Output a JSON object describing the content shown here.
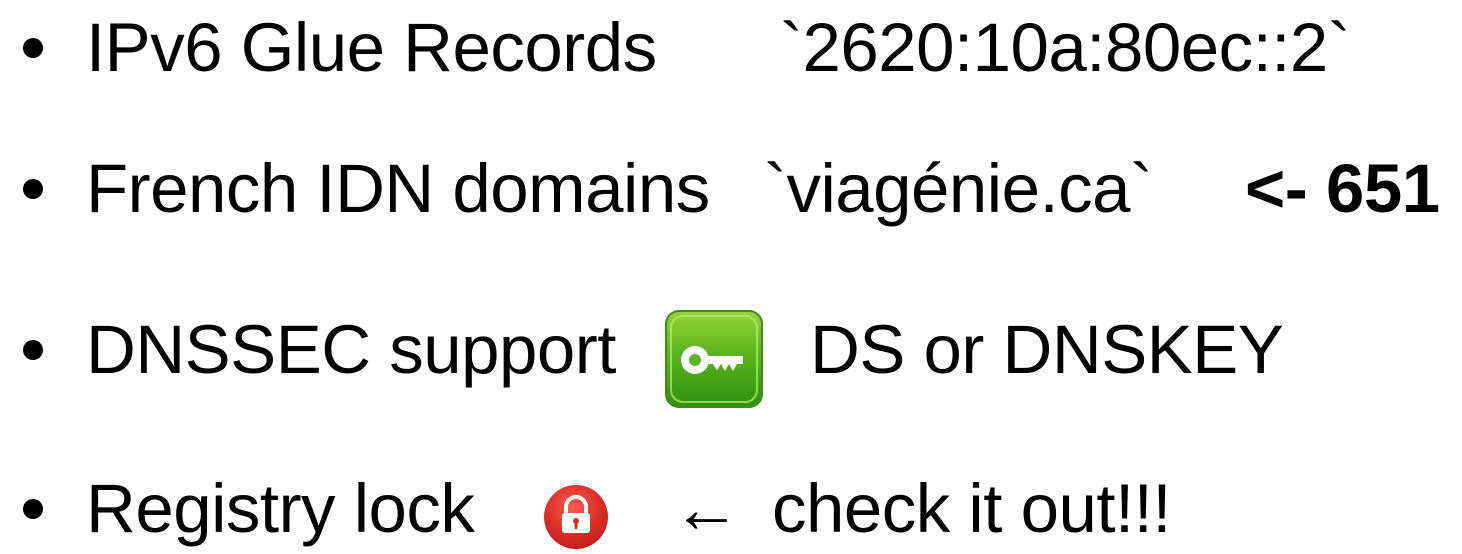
{
  "items": [
    {
      "label": "IPv6 Glue Records",
      "detail": "`2620:10a:80ec::2`"
    },
    {
      "label": "French IDN domains",
      "detail": "`viagénie.ca`",
      "extra": "<- 651"
    },
    {
      "label": "DNSSEC support",
      "detail": "DS or DNSKEY",
      "icon": "key-icon"
    },
    {
      "label": "Registry lock",
      "detail": "check it out!!!",
      "icon": "lock-icon",
      "arrow": "←"
    }
  ],
  "colors": {
    "text": "#000000",
    "key_badge": "#56b21c",
    "lock_badge": "#d62a24"
  }
}
